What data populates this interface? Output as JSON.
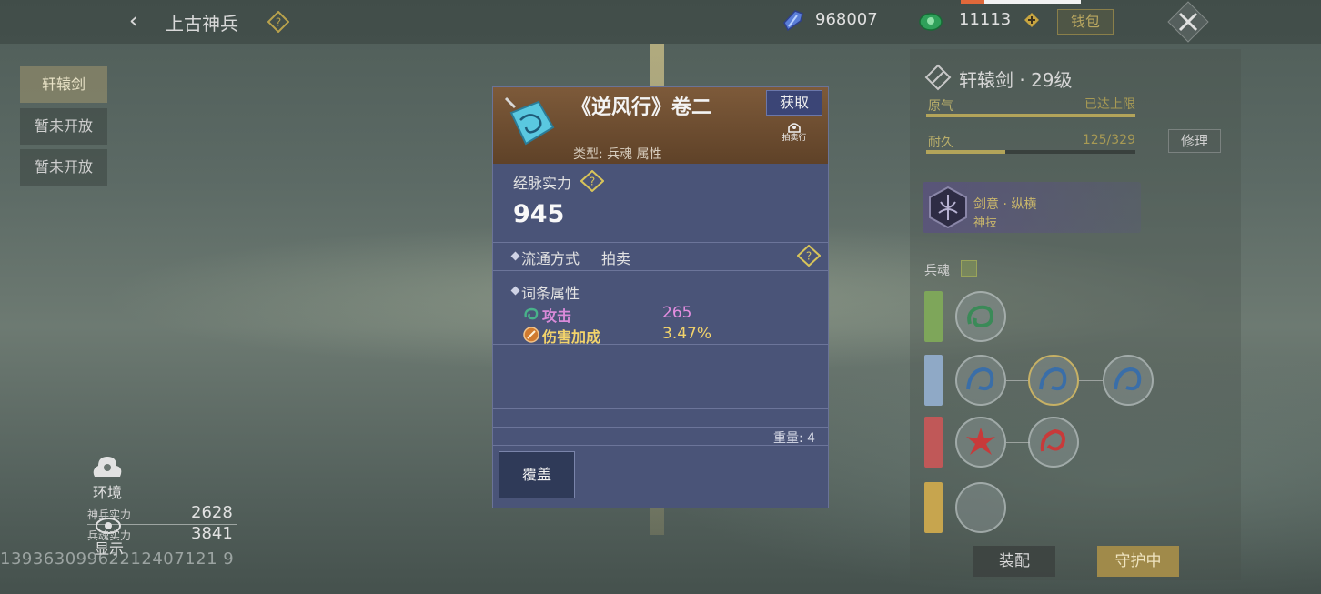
{
  "header": {
    "title": "上古神兵",
    "currency1": "968007",
    "currency2": "11113",
    "wallet_label": "钱包"
  },
  "left_tabs": [
    {
      "label": "轩辕剑"
    },
    {
      "label": "暂未开放"
    },
    {
      "label": "暂未开放"
    }
  ],
  "bottom_left": {
    "env_label": "环境",
    "stats": [
      {
        "label": "神兵实力",
        "value": "2628"
      },
      {
        "label": "兵魂实力",
        "value": "3841"
      }
    ],
    "show_label": "显示",
    "uid": "13936309962212407121 9"
  },
  "popup": {
    "item_name": "《逆风行》卷二",
    "item_type": "类型: 兵魂 属性",
    "obtain_label": "获取",
    "auction_label": "拍卖行",
    "meridian_label": "经脉实力",
    "meridian_value": "945",
    "circulation_label": "流通方式",
    "circulation_value": "拍卖",
    "attr_title": "词条属性",
    "attrs": [
      {
        "name": "攻击",
        "value": "265",
        "name_color": "#d98ad9",
        "value_color": "#e48ee0"
      },
      {
        "name": "伤害加成",
        "value": "3.47%",
        "name_color": "#f2d36b",
        "value_color": "#f2d36b"
      }
    ],
    "weight": "重量: 4",
    "cover_label": "覆盖"
  },
  "right_panel": {
    "weapon_title": "轩辕剑 · 29级",
    "yuanqi_label": "原气",
    "yuanqi_value": "已达上限",
    "durability_label": "耐久",
    "durability_value": "125/329",
    "durability_fraction": 0.38,
    "repair_label": "修理",
    "skill_name": "剑意 · 纵横",
    "skill_sub": "神技",
    "binghun_label": "兵魂",
    "row_colors": [
      "#7ea65a",
      "#8fa9c6",
      "#c05858",
      "#c7a54e"
    ],
    "equip_label": "装配",
    "guard_label": "守护中"
  }
}
